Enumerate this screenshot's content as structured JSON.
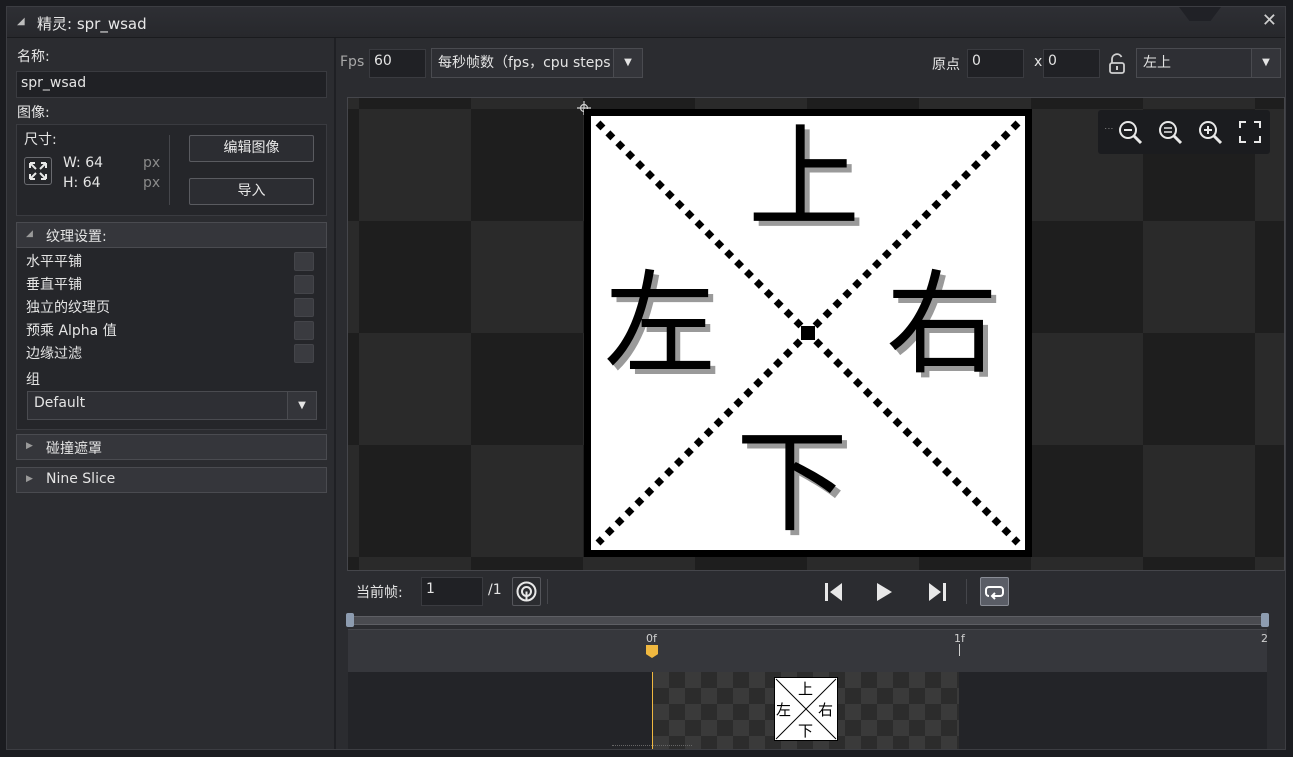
{
  "window": {
    "title": "精灵:  spr_wsad",
    "close_glyph": "✕"
  },
  "left_panel": {
    "name_label": "名称:",
    "name_value": "spr_wsad",
    "image_label": "图像:",
    "size_label": "尺寸:",
    "width_text": "W: 64",
    "height_text": "H: 64",
    "unit": "px",
    "edit_image_button": "编辑图像",
    "import_button": "导入",
    "texture_section": "纹理设置:",
    "options": [
      "水平平铺",
      "垂直平铺",
      "独立的纹理页",
      "预乘 Alpha 值",
      "边缘过滤"
    ],
    "group_label": "组",
    "group_value": "Default",
    "collision_section": "碰撞遮罩",
    "nine_slice_section": "Nine Slice"
  },
  "toolbar": {
    "fps_label": "Fps",
    "fps_value": "60",
    "fps_mode": "每秒帧数（fps，cpu steps",
    "origin_label": "原点",
    "origin_x": "0",
    "origin_sep": "x",
    "origin_y": "0",
    "origin_preset": "左上"
  },
  "sprite": {
    "top": "上",
    "left": "左",
    "right": "右",
    "bottom": "下"
  },
  "zoom_icons": [
    "zoom-out-icon",
    "zoom-reset-icon",
    "zoom-in-icon",
    "fit-screen-icon"
  ],
  "playback": {
    "current_frame_label": "当前帧:",
    "current_frame": "1",
    "total_frames": "/1"
  },
  "timeline": {
    "markers": [
      "0f",
      "1f",
      "2"
    ]
  },
  "colors": {
    "accent": "#f0b840",
    "bg": "#2b2c30",
    "panel": "#25262a"
  }
}
